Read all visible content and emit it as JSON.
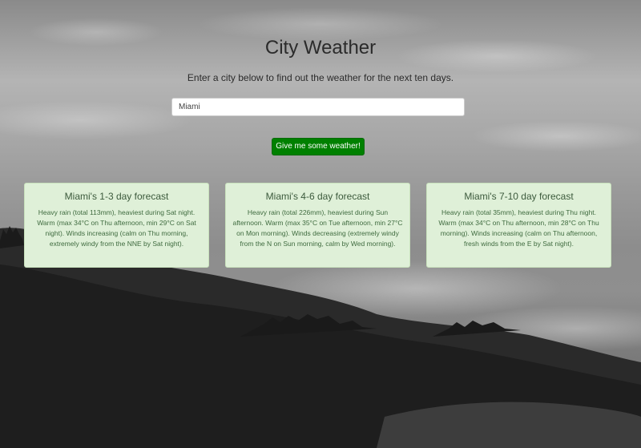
{
  "page": {
    "title": "City Weather",
    "subtitle": "Enter a city below to find out the weather for the next ten days."
  },
  "search": {
    "value": "Miami",
    "button_label": "Give me some weather!"
  },
  "forecasts": [
    {
      "title": "Miami's 1-3 day forecast",
      "text": "Heavy rain (total 113mm), heaviest during Sat night. Warm (max 34°C on Thu afternoon, min 29°C on Sat night). Winds increasing (calm on Thu morning, extremely windy from the NNE by Sat night)."
    },
    {
      "title": "Miami's 4-6 day forecast",
      "text": "Heavy rain (total 226mm), heaviest during Sun afternoon. Warm (max 35°C on Tue afternoon, min 27°C on Mon morning). Winds decreasing (extremely windy from the N on Sun morning, calm by Wed morning)."
    },
    {
      "title": "Miami's 7-10 day forecast",
      "text": "Heavy rain (total 35mm), heaviest during Thu night. Warm (max 34°C on Thu afternoon, min 28°C on Thu morning). Winds increasing (calm on Thu afternoon, fresh winds from the E by Sat night)."
    }
  ],
  "colors": {
    "button": "#008000",
    "card_background": "#dff0d8"
  }
}
